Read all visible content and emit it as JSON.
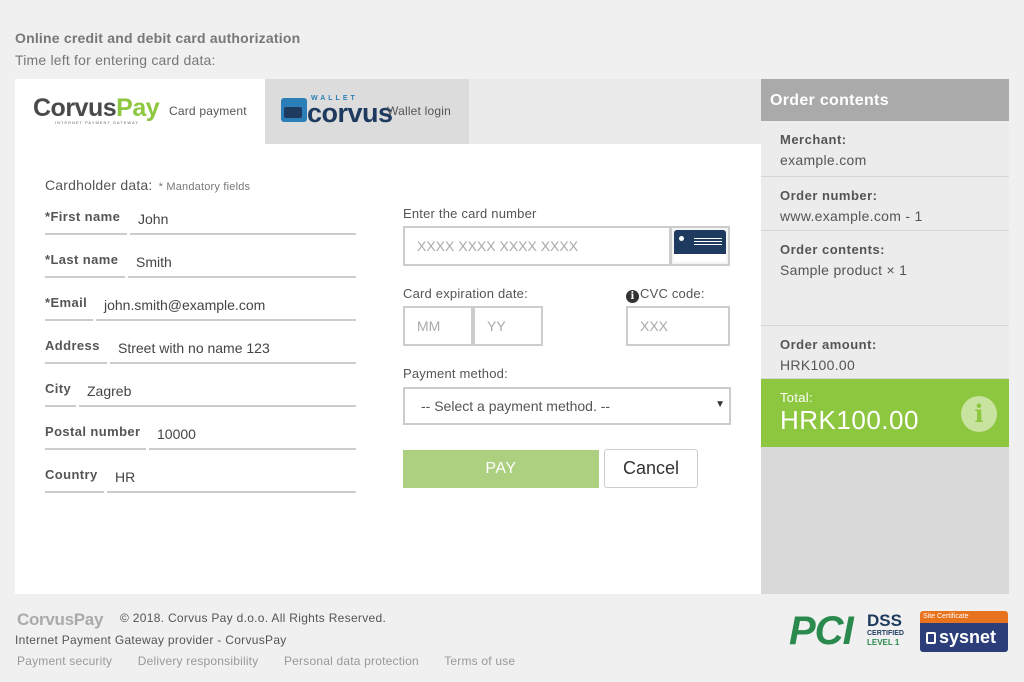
{
  "header": {
    "title": "Online credit and debit card authorization",
    "timer_label": "Time left for entering card data:"
  },
  "tabs": {
    "card": {
      "logo_word_a": "Corvus",
      "logo_word_b": "Pay",
      "logo_sub": "INTERNET PAYMENT GATEWAY",
      "label": "Card payment"
    },
    "wallet": {
      "logo_tag": "WALLET",
      "logo_word": "corvus",
      "label": "Wallet login"
    }
  },
  "cardholder": {
    "title": "Cardholder data:",
    "mandatory": "* Mandatory fields",
    "fields": [
      {
        "label": "*First name",
        "value": "John"
      },
      {
        "label": "*Last name",
        "value": "Smith"
      },
      {
        "label": "*Email",
        "value": "john.smith@example.com"
      },
      {
        "label": "Address",
        "value": "Street with no name 123"
      },
      {
        "label": "City",
        "value": "Zagreb"
      },
      {
        "label": "Postal number",
        "value": "10000"
      },
      {
        "label": "Country",
        "value": "HR"
      }
    ]
  },
  "card": {
    "number_label": "Enter the card number",
    "number_placeholder": "XXXX XXXX XXXX XXXX",
    "expiry_label": "Card expiration date:",
    "mm_placeholder": "MM",
    "yy_placeholder": "YY",
    "cvc_label": "CVC code:",
    "cvc_placeholder": "XXX",
    "method_label": "Payment method:",
    "method_selected": "-- Select a payment method. --",
    "pay_label": "PAY",
    "cancel_label": "Cancel"
  },
  "order": {
    "title": "Order contents",
    "merchant_label": "Merchant:",
    "merchant_value": "example.com",
    "number_label": "Order number:",
    "number_value": "www.example.com - 1",
    "contents_label": "Order contents:",
    "contents_value": "Sample product × 1",
    "amount_label": "Order amount:",
    "amount_value": "HRK100.00",
    "total_label": "Total:",
    "total_value": "HRK100.00"
  },
  "footer": {
    "logo": "CorvusPay",
    "copyright": "© 2018. Corvus Pay d.o.o. All Rights Reserved.",
    "provider": "Internet Payment Gateway provider - CorvusPay",
    "links": [
      "Payment security",
      "Delivery responsibility",
      "Personal data protection",
      "Terms of use"
    ],
    "pci": {
      "mark": "PCI",
      "dss": "DSS",
      "certified": "CERTIFIED",
      "level": "LEVEL 1"
    },
    "sysnet": {
      "top": "Site Certificate",
      "name": "sysnet"
    }
  },
  "colors": {
    "brand_green": "#8dc63f",
    "navy": "#1e3a5f",
    "pay_button": "#acd080"
  },
  "icons": [
    "card-icon",
    "info-icon",
    "chevron-down-icon",
    "lock-icon"
  ]
}
